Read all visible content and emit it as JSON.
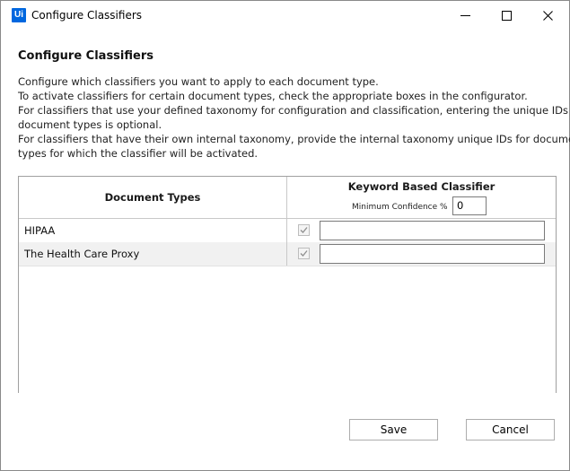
{
  "window": {
    "title": "Configure Classifiers",
    "app_icon_text": "Ui",
    "brand_color": "#0067df"
  },
  "heading": "Configure Classifiers",
  "description": [
    "Configure which classifiers you want to apply to each document type.",
    "To activate classifiers for certain document types, check the appropriate boxes in the configurator.",
    "For classifiers that use your defined taxonomy for configuration and classification, entering the unique IDs for",
    "document types is optional.",
    "For classifiers that have their own internal taxonomy, provide the internal taxonomy unique IDs for document",
    "types for which the classifier will be activated."
  ],
  "grid": {
    "doc_types_header": "Document Types",
    "classifier_header": "Keyword Based Classifier",
    "min_confidence_label": "Minimum Confidence %",
    "min_confidence_value": "0",
    "rows": [
      {
        "label": "HIPAA",
        "checked": true,
        "id_value": ""
      },
      {
        "label": "The Health Care Proxy",
        "checked": true,
        "id_value": ""
      }
    ]
  },
  "buttons": {
    "save": "Save",
    "cancel": "Cancel"
  },
  "icons": {
    "minimize": "minimize-icon",
    "maximize": "maximize-icon",
    "close": "close-icon",
    "check": "check-icon"
  }
}
